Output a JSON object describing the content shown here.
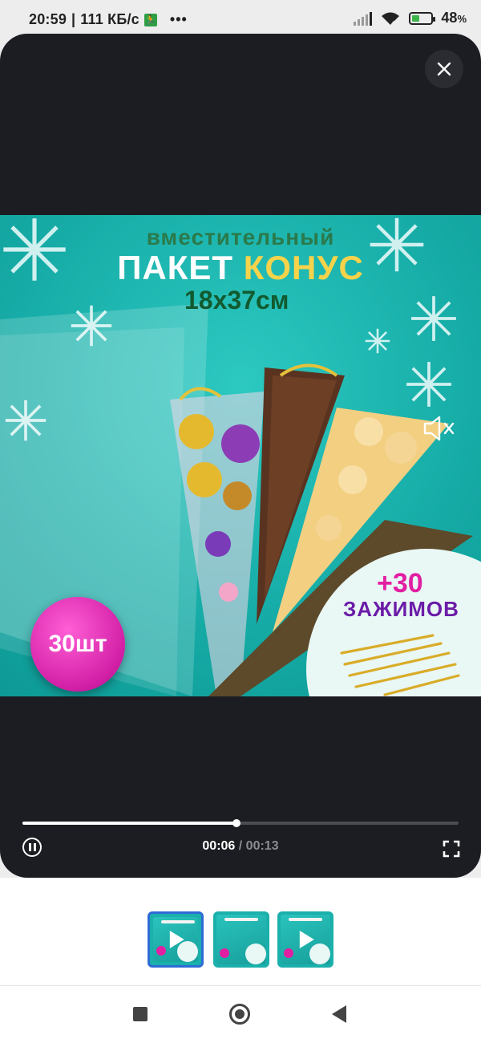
{
  "status_bar": {
    "time": "20:59",
    "speed": "111 КБ/с",
    "battery": "48",
    "battery_unit": "%",
    "battery_level": 0.48
  },
  "player": {
    "close_icon": "close-icon",
    "current_time": "00:06",
    "separator": "/",
    "total_time": "00:13",
    "progress": 0.49
  },
  "video_frame": {
    "line1": "вместительный",
    "line2_white": "ПАКЕТ",
    "line2_yellow": "КОНУС",
    "line3": "18х37см",
    "badge_count": "30шт",
    "clips_plus": "+30",
    "clips_word": "ЗАЖИМОВ",
    "colors": {
      "background": "#1cb5b0",
      "title_white": "#ffffff",
      "title_yellow": "#f6d34a",
      "title_green": "#2b7a4b",
      "badge_magenta": "#d21fa6",
      "clips_purple": "#6b1ca8"
    }
  },
  "thumbnails": {
    "count": 3,
    "active_index": 0
  },
  "nav": {
    "recent_icon": "square-icon",
    "home_icon": "circle-home-icon",
    "back_icon": "triangle-back-icon"
  }
}
